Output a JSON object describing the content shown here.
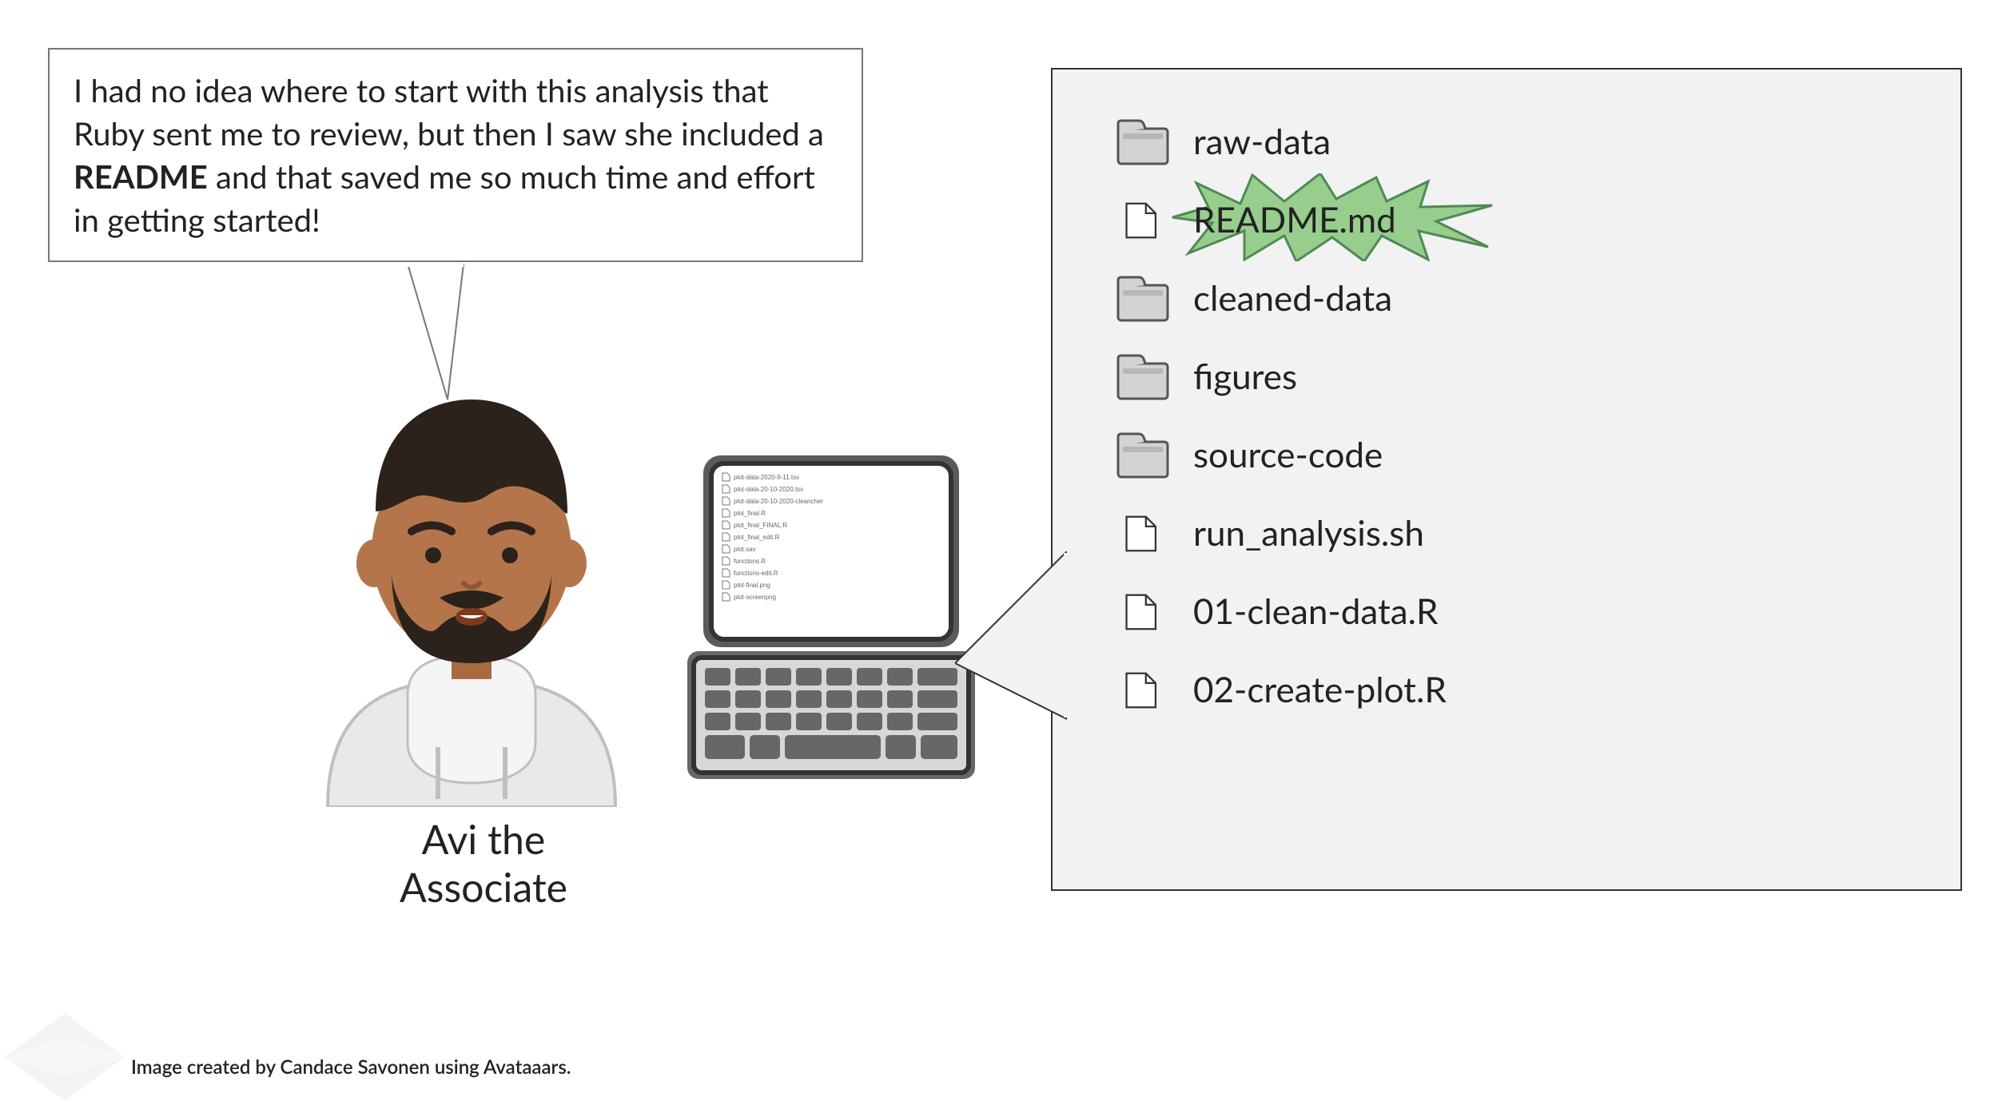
{
  "speech": {
    "text_before": "I had no idea where to start with this analysis that Ruby sent me to review, but then I saw she included a ",
    "bold": "README",
    "text_after": " and that saved me so much time and effort in getting started!"
  },
  "avatar": {
    "name_line1": "Avi the",
    "name_line2": "Associate"
  },
  "files": [
    {
      "type": "folder",
      "label": "raw-data",
      "highlighted": false
    },
    {
      "type": "file",
      "label": "README.md",
      "highlighted": true
    },
    {
      "type": "folder",
      "label": "cleaned-data",
      "highlighted": false
    },
    {
      "type": "folder",
      "label": "figures",
      "highlighted": false
    },
    {
      "type": "folder",
      "label": "source-code",
      "highlighted": false
    },
    {
      "type": "file",
      "label": "run_analysis.sh",
      "highlighted": false
    },
    {
      "type": "file",
      "label": "01-clean-data.R",
      "highlighted": false
    },
    {
      "type": "file",
      "label": "02-create-plot.R",
      "highlighted": false
    }
  ],
  "laptop_files": [
    "plot-data-2020-9-11.tsv",
    "plot-data-20-10-2020.tsv",
    "plot-data-20-10-2020-cleancher",
    "plot_final.R",
    "plot_final_FINAL.R",
    "plot_final_edit.R",
    "plot.sav",
    "functions.R",
    "functions-edit.R",
    "plot-final.png",
    "plot-screenpng"
  ],
  "credit": "Image created by Candace Savonen using Avataaars."
}
